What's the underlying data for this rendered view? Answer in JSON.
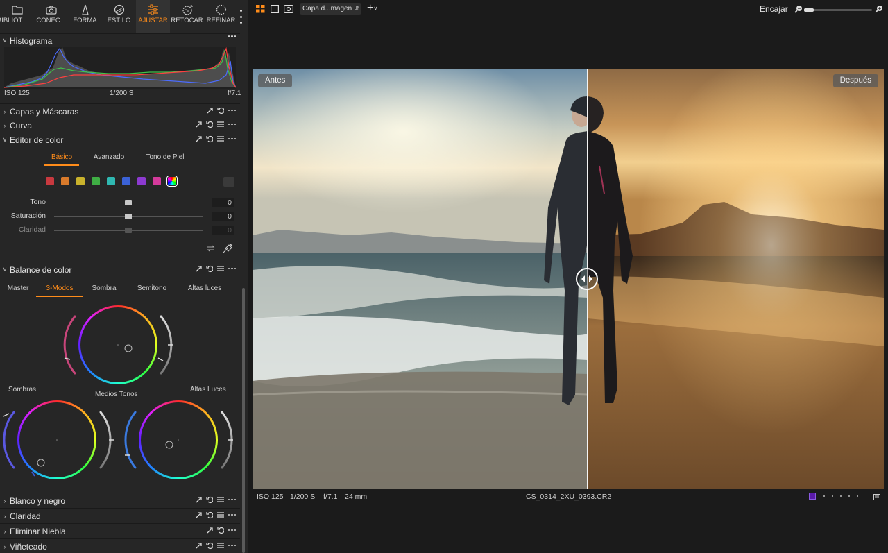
{
  "tool_tabs": [
    {
      "label": "BIBLIOT...",
      "icon": "folder-icon"
    },
    {
      "label": "CONEC...",
      "icon": "camera-tether-icon"
    },
    {
      "label": "FORMA",
      "icon": "crop-shape-icon"
    },
    {
      "label": "ESTILO",
      "icon": "style-icon"
    },
    {
      "label": "AJUSTAR",
      "icon": "sliders-icon",
      "active": true
    },
    {
      "label": "RETOCAR",
      "icon": "retouch-icon"
    },
    {
      "label": "REFINAR",
      "icon": "refine-icon"
    }
  ],
  "histogram": {
    "title": "Histograma",
    "iso": "ISO 125",
    "shutter": "1/200 S",
    "aperture": "f/7.1"
  },
  "sections": {
    "layers": "Capas y Máscaras",
    "curve": "Curva",
    "color_editor": "Editor de color",
    "color_balance": "Balance de color",
    "black_white": "Blanco y negro",
    "clarity": "Claridad",
    "dehaze": "Eliminar Niebla",
    "vignette": "Viñeteado"
  },
  "color_editor": {
    "tabs": [
      "Básico",
      "Avanzado",
      "Tono de Piel"
    ],
    "active_tab": "Básico",
    "swatches": [
      "#c8393f",
      "#d97a2b",
      "#c9b22c",
      "#3fae44",
      "#2fb8b1",
      "#3b62d6",
      "#8d3ad0",
      "#d43a9b"
    ],
    "more_label": "...",
    "sliders": [
      {
        "label": "Tono",
        "value": "0"
      },
      {
        "label": "Saturación",
        "value": "0"
      },
      {
        "label": "Claridad",
        "value": "0"
      }
    ]
  },
  "color_balance": {
    "tabs": [
      "Master",
      "3-Modos",
      "Sombra",
      "Semitono",
      "Altas luces"
    ],
    "active_tab": "3-Modos",
    "wheel_labels": {
      "shadows": "Sombras",
      "midtones": "Medios Tonos",
      "highlights": "Altas Luces"
    }
  },
  "topbar": {
    "layer_select": "Capa d...magen",
    "fit_label": "Encajar",
    "zoom_fraction": 0.14
  },
  "viewer": {
    "before_label": "Antes",
    "after_label": "Después"
  },
  "statusbar": {
    "iso": "ISO 125",
    "shutter": "1/200 S",
    "aperture": "f/7.1",
    "focal": "24 mm",
    "filename": "CS_0314_2XU_0393.CR2",
    "color_tag": "#5a1aa8"
  },
  "colors": {
    "accent": "#ff8c1a",
    "panel_bg": "#262626",
    "app_bg": "#1b1b1b"
  }
}
